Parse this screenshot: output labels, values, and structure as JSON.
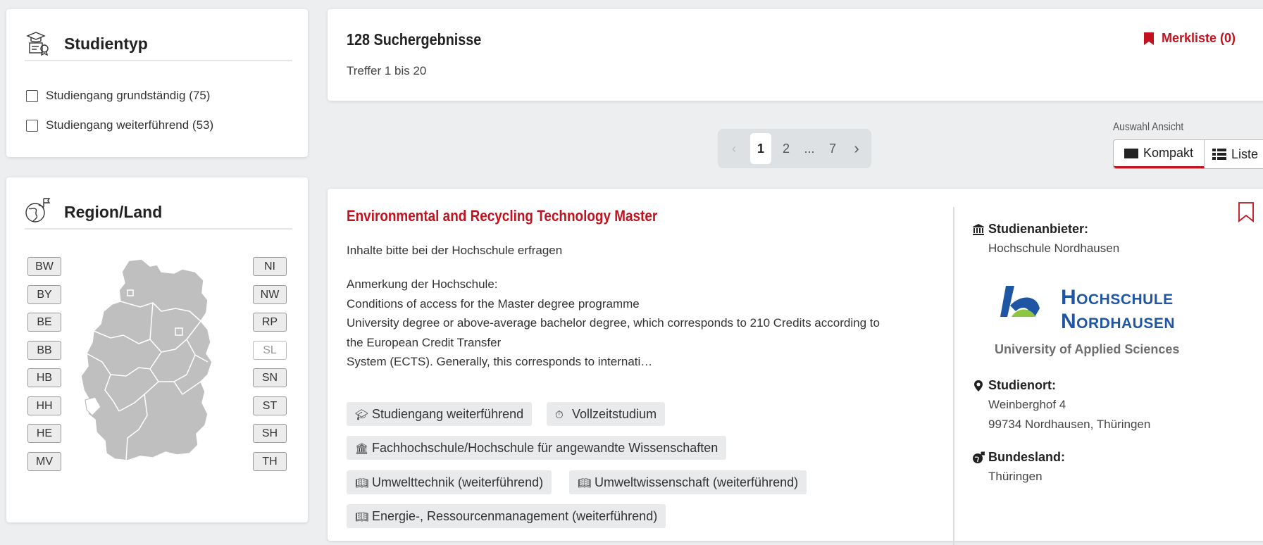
{
  "studientyp": {
    "title": "Studientyp",
    "options": [
      {
        "label": "Studiengang grundständig (75)"
      },
      {
        "label": "Studiengang weiterführend (53)"
      }
    ]
  },
  "region": {
    "title": "Region/Land",
    "states_left": [
      "BW",
      "BY",
      "BE",
      "BB",
      "HB",
      "HH",
      "HE",
      "MV"
    ],
    "states_right": [
      "NI",
      "NW",
      "RP",
      "SL",
      "SN",
      "ST",
      "SH",
      "TH"
    ],
    "disabled_state": "SL",
    "map_color": "#bfbfbf"
  },
  "results": {
    "count": "128 Suchergebnisse",
    "range": "Treffer 1 bis 20",
    "merkliste": "Merkliste (0)"
  },
  "pagination": {
    "pages": [
      "1",
      "2",
      "...",
      "7"
    ],
    "current": "1"
  },
  "view": {
    "label": "Auswahl Ansicht",
    "compact": "Kompakt",
    "list": "Liste",
    "active": "Kompakt"
  },
  "result": {
    "title": "Environmental and Recycling Technology Master",
    "subtitle": "Inhalte bitte bei der Hochschule erfragen",
    "note_label": "Anmerkung der Hochschule:",
    "note_lines": [
      "Conditions of access for the Master degree programme",
      "University degree or above-average bachelor degree, which corresponds to 210 Credits according to",
      "the European Credit Transfer",
      "System (ECTS). Generally, this corresponds to internati…"
    ],
    "tags": [
      {
        "icon": "graduation-cap-icon",
        "label": "Studiengang weiterführend"
      },
      {
        "icon": "stopwatch-icon",
        "label": "Vollzeitstudium"
      },
      {
        "icon": "institution-icon",
        "label": "Fachhochschule/Hochschule für angewandte Wissenschaften"
      },
      {
        "icon": "book-icon",
        "label": "Umwelttechnik (weiterführend)"
      },
      {
        "icon": "book-icon",
        "label": "Umweltwissenschaft (weiterführend)"
      },
      {
        "icon": "book-icon",
        "label": "Energie-, Ressourcenmanagement (weiterführend)"
      }
    ],
    "provider_label": "Studienanbieter:",
    "provider": "Hochschule Nordhausen",
    "logo": {
      "line1": "Hochschule",
      "line2": "Nordhausen",
      "tagline": "University of Applied Sciences"
    },
    "location_label": "Studienort:",
    "location_street": "Weinberghof 4",
    "location_city": "99734 Nordhausen, Thüringen",
    "state_label": "Bundesland:",
    "state": "Thüringen"
  },
  "colors": {
    "accent": "#c1121f",
    "logo_blue": "#1f56a4",
    "logo_green": "#8dc63f"
  }
}
